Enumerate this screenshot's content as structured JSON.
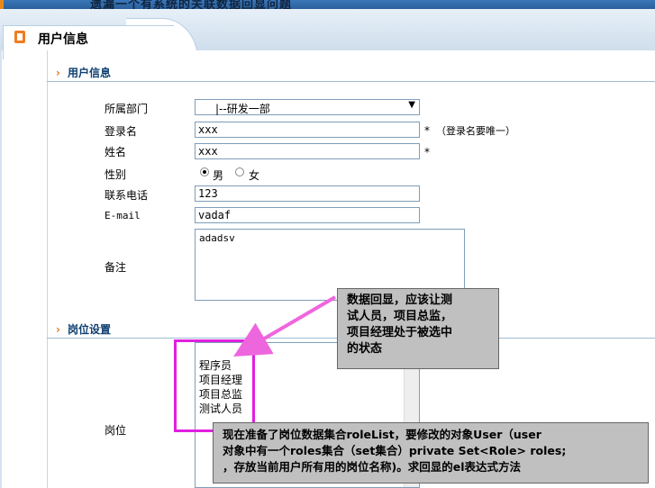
{
  "header": {
    "top_title": "遗漏一个有系统的关联数据回显问题"
  },
  "tab": {
    "title": "用户信息"
  },
  "sections": {
    "user_info": "用户信息",
    "post": "岗位设置"
  },
  "form": {
    "department": {
      "label": "所属部门",
      "value": "|--研发一部"
    },
    "login": {
      "label": "登录名",
      "value": "xxx",
      "star": "*",
      "hint": "（登录名要唯一）"
    },
    "name": {
      "label": "姓名",
      "value": "xxx",
      "star": "*"
    },
    "gender": {
      "label": "性别",
      "male": "男",
      "female": "女",
      "selected": "男"
    },
    "phone": {
      "label": "联系电话",
      "value": "123"
    },
    "email": {
      "label": "E-mail",
      "value": "vadaf"
    },
    "remark": {
      "label": "备注",
      "value": "adadsv"
    }
  },
  "post": {
    "label": "岗位",
    "options": [
      "程序员",
      "项目经理",
      "项目总监",
      "测试人员"
    ]
  },
  "annotations": {
    "callout1": [
      "数据回显，应该让测",
      "试人员，项目总监，",
      "项目经理处于被选中",
      "的状态"
    ],
    "callout2": [
      "现在准备了岗位数据集合roleList，要修改的对象User（user",
      "对象中有一个roles集合（set集合）private Set<Role> roles;",
      "，存放当前用户所有用的岗位名称)。求回显的el表达式方法"
    ],
    "highlight_color": "#e020e0",
    "arrow_color": "#ee66dd"
  }
}
